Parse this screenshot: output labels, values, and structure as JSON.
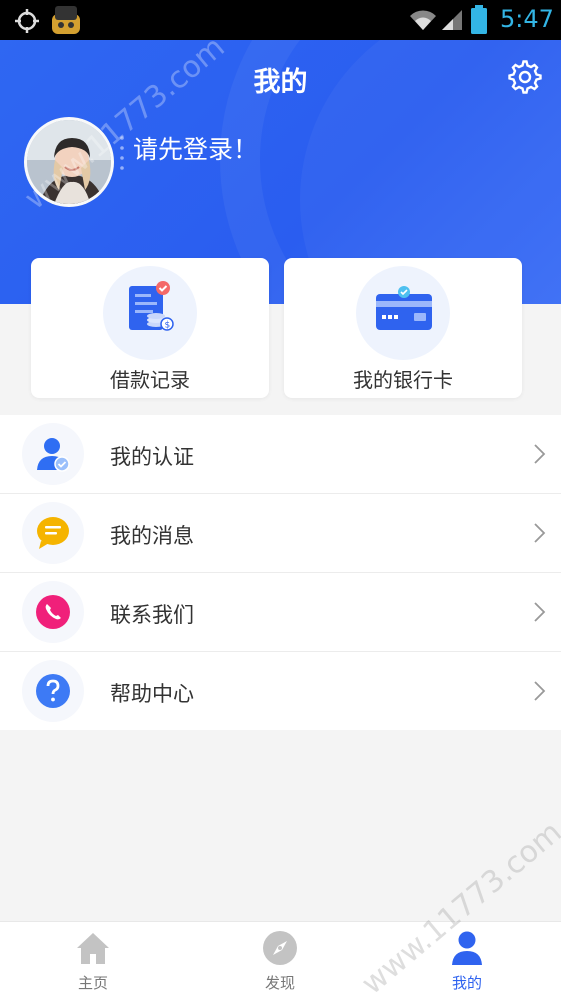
{
  "status_bar": {
    "time": "5:47",
    "icons": [
      "crosshair-icon",
      "app-icon",
      "wifi-icon",
      "signal-icon",
      "battery-icon"
    ]
  },
  "header": {
    "title": "我的",
    "login_prompt": "请先登录！",
    "settings_icon": "gear-icon"
  },
  "cards": [
    {
      "label": "借款记录",
      "icon": "loan-record-icon"
    },
    {
      "label": "我的银行卡",
      "icon": "bank-card-icon"
    }
  ],
  "menu": [
    {
      "label": "我的认证",
      "icon": "user-verify-icon",
      "color": "#2f6ef3"
    },
    {
      "label": "我的消息",
      "icon": "message-icon",
      "color": "#f5b400"
    },
    {
      "label": "联系我们",
      "icon": "phone-icon",
      "color": "#f0207a"
    },
    {
      "label": "帮助中心",
      "icon": "help-icon",
      "color": "#3d7af5"
    }
  ],
  "bottom_nav": [
    {
      "label": "主页",
      "icon": "home-icon",
      "active": false
    },
    {
      "label": "发现",
      "icon": "compass-icon",
      "active": false
    },
    {
      "label": "我的",
      "icon": "person-icon",
      "active": true
    }
  ],
  "watermark": "www.11773.com",
  "colors": {
    "primary": "#2f63ef",
    "background": "#f4f4f4"
  }
}
